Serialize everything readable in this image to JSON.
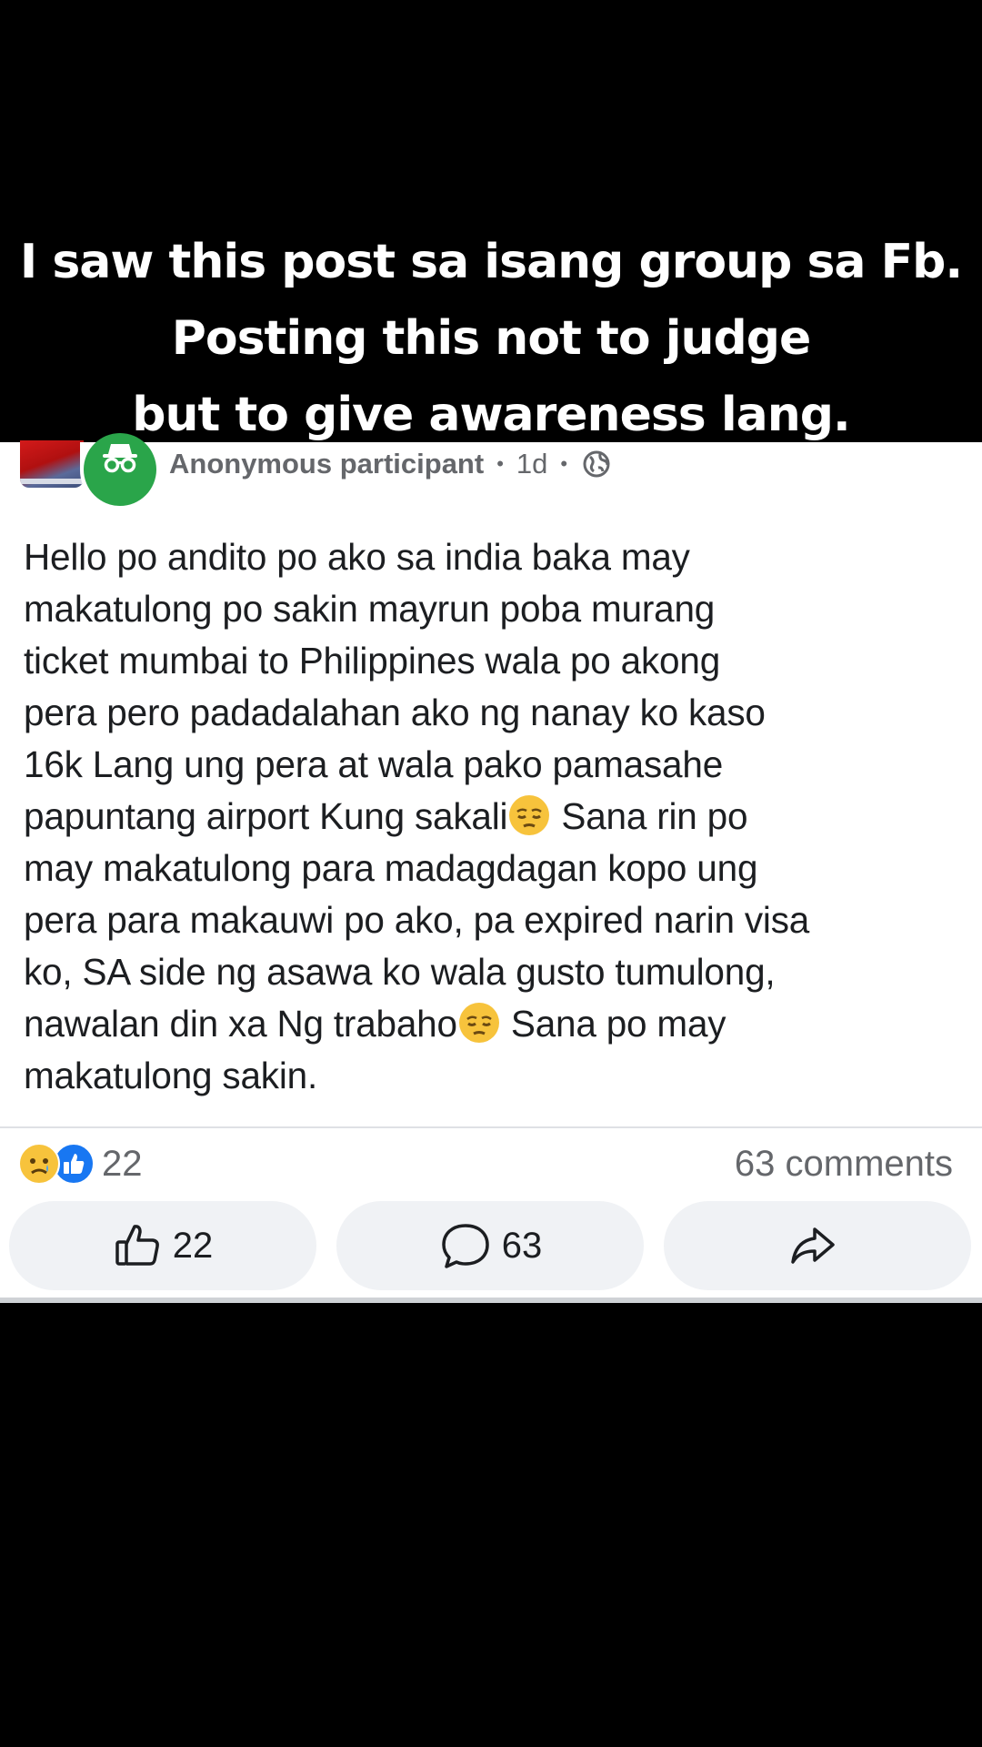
{
  "caption": {
    "line1": "I saw this post sa isang group sa Fb.",
    "line2": "Posting this not to judge",
    "line3": "but to give awareness lang."
  },
  "post": {
    "author": "Anonymous participant",
    "separator": "•",
    "time": "1d",
    "privacy_icon": "globe-icon",
    "body_lines": [
      "Hello po andito po ako sa india baka may",
      "makatulong po sakin mayrun poba murang",
      "ticket mumbai to Philippines wala po akong",
      "pera pero padadalahan ako ng nanay ko kaso",
      "16k Lang ung pera at wala pako pamasahe",
      "papuntang airport Kung sakali",
      " Sana rin po",
      "may makatulong para madagdagan kopo ung",
      "pera para makauwi po ako, pa expired narin visa",
      "ko, SA side ng asawa ko wala gusto tumulong,",
      "nawalan din xa Ng trabaho",
      " Sana po may",
      "makatulong sakin."
    ],
    "emoji_name": "pensive-face-emoji"
  },
  "stats": {
    "reaction_count": "22",
    "comments_label": "63 comments"
  },
  "actions": {
    "like_count": "22",
    "comment_count": "63",
    "share_icon": "share-icon"
  },
  "colors": {
    "anon_green": "#2aa54a",
    "like_blue": "#1877f2",
    "sad_yellow": "#f7c33c",
    "meta_gray": "#65676b"
  }
}
